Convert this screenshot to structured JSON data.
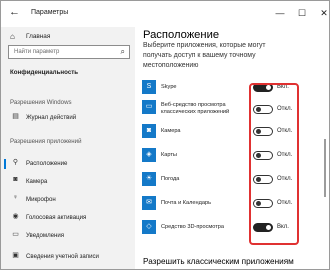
{
  "window": {
    "title": "Параметры",
    "back_icon": "back-arrow-icon",
    "minimize": "—",
    "maximize": "☐",
    "close": "✕"
  },
  "sidebar": {
    "home_label": "Главная",
    "search_placeholder": "Найти параметр",
    "confidentiality_label": "Конфиденциальность",
    "windows_permissions_label": "Разрешения Windows",
    "app_permissions_label": "Разрешения приложений",
    "items": [
      {
        "label": "Журнал действий",
        "icon": "history-icon"
      },
      {
        "label": "Расположение",
        "icon": "location-icon",
        "active": true
      },
      {
        "label": "Камера",
        "icon": "camera-icon"
      },
      {
        "label": "Микрофон",
        "icon": "microphone-icon"
      },
      {
        "label": "Голосовая активация",
        "icon": "voice-activation-icon"
      },
      {
        "label": "Уведомления",
        "icon": "notifications-icon"
      },
      {
        "label": "Сведения учетной записи",
        "icon": "account-info-icon"
      }
    ]
  },
  "main": {
    "title": "Расположение",
    "description_lines": [
      "Выберите приложения, которые могут",
      "получать доступ к вашему точному",
      "местоположению"
    ],
    "apps": [
      {
        "name": "Skype",
        "state": "Вкл.",
        "on": true,
        "icon": "skype-icon"
      },
      {
        "name_lines": [
          "Веб-средство просмотра",
          "классических приложений"
        ],
        "state": "Откл.",
        "on": false,
        "icon": "web-viewer-icon"
      },
      {
        "name": "Камера",
        "state": "Откл.",
        "on": false,
        "icon": "camera-app-icon"
      },
      {
        "name": "Карты",
        "state": "Откл.",
        "on": false,
        "icon": "maps-app-icon"
      },
      {
        "name": "Погода",
        "state": "Откл.",
        "on": false,
        "icon": "weather-app-icon"
      },
      {
        "name": "Почта и Календарь",
        "state": "Откл.",
        "on": false,
        "icon": "mail-calendar-app-icon"
      },
      {
        "name": "Средство 3D-просмотра",
        "state": "Вкл.",
        "on": true,
        "icon": "3d-viewer-app-icon"
      }
    ],
    "bottom_link": "Разрешить классическим приложениям"
  },
  "colors": {
    "accent": "#0078d7",
    "highlight": "#e03131",
    "app_tile": "#1479c8",
    "sidebar_bg": "#f2f2f2"
  }
}
